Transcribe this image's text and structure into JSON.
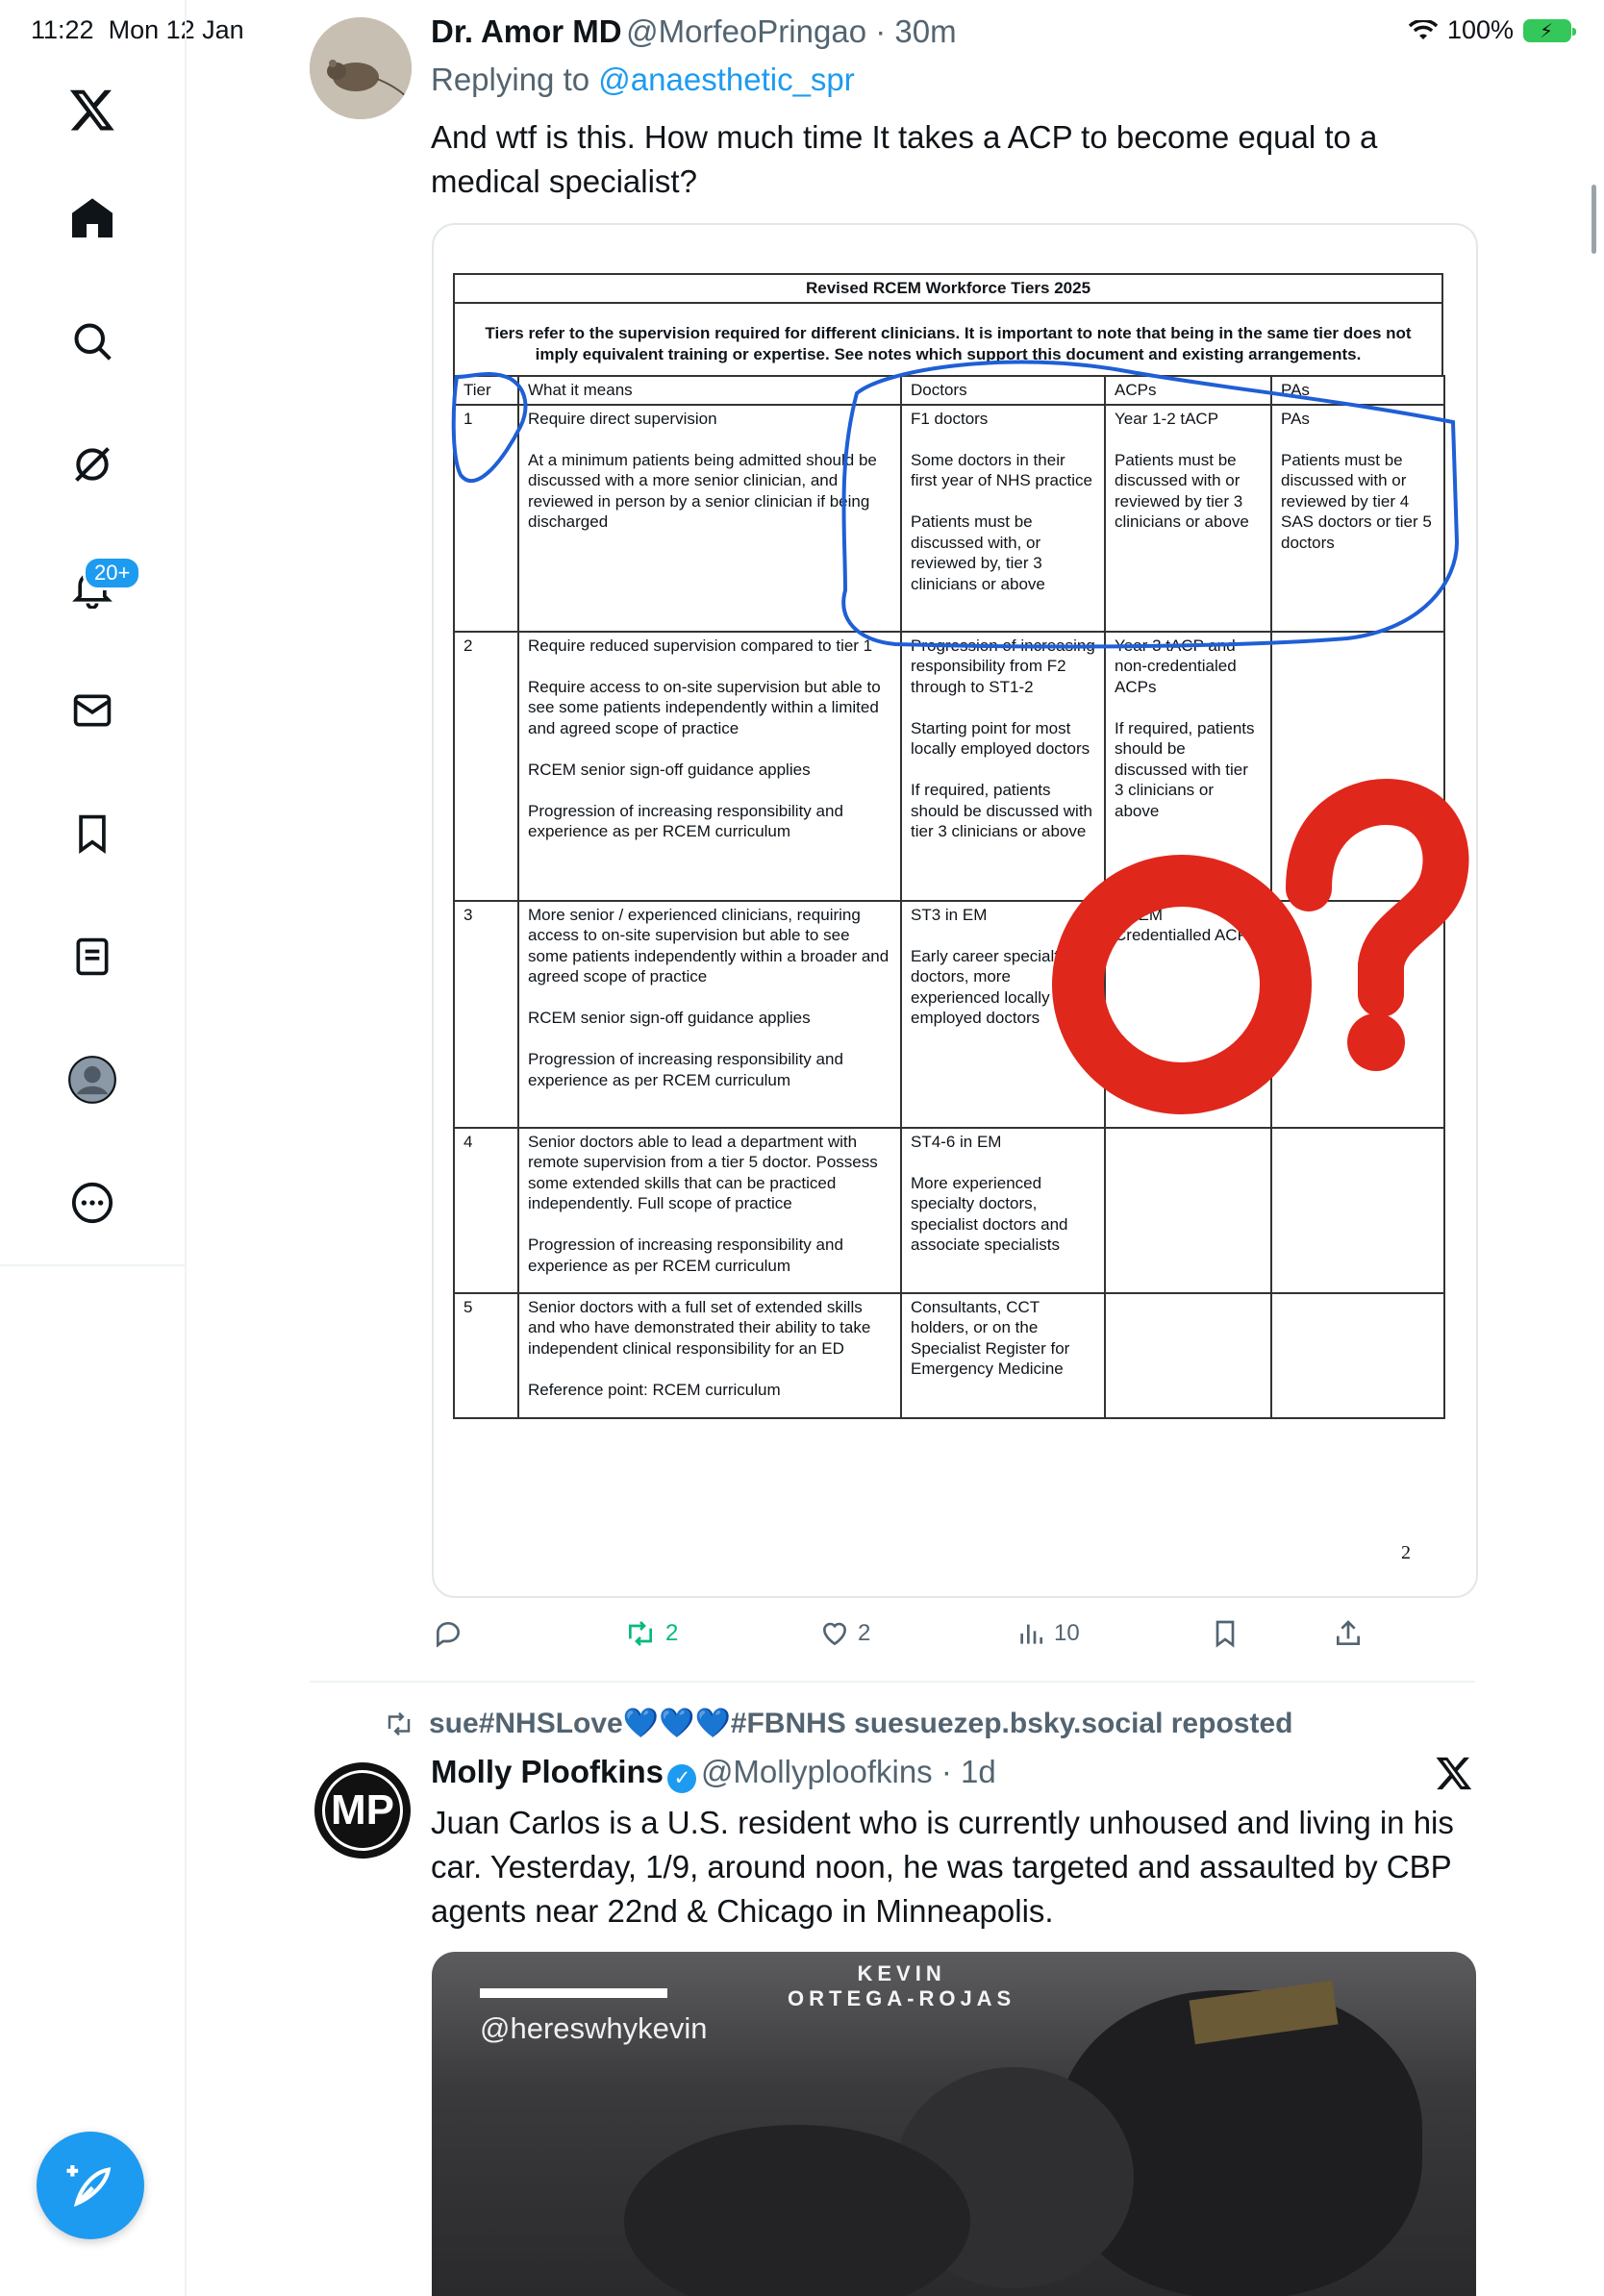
{
  "status_bar": {
    "time": "11:22",
    "date": "Mon 12 Jan",
    "battery": "100%"
  },
  "nav": {
    "notification_badge": "20+"
  },
  "tweet1": {
    "name": "Dr. Amor MD",
    "handle": "@MorfeoPringao",
    "time": "30m",
    "replying_label": "Replying to",
    "replying_handle": "@anaesthetic_spr",
    "text": "And wtf is this. How much time It takes a ACP to become equal to a medical specialist?",
    "document": {
      "title": "Revised RCEM Workforce Tiers 2025",
      "intro": "Tiers refer to the supervision required for different clinicians. It is important to note that being in the same tier does not imply equivalent training or expertise. See notes which support this document and existing arrangements.",
      "headers": [
        "Tier",
        "What it means",
        "Doctors",
        "ACPs",
        "PAs"
      ],
      "rows": [
        [
          "1",
          "Require direct supervision\n\nAt a minimum patients being admitted should be discussed with a more senior clinician, and reviewed in person by a senior clinician if being discharged",
          "F1 doctors\n\nSome doctors in their first year of NHS practice\n\nPatients must be discussed with, or reviewed by, tier 3 clinicians or above",
          "Year 1-2 tACP\n\nPatients must be discussed with or reviewed by tier 3 clinicians or above",
          "PAs\n\nPatients must be discussed with or reviewed by tier 4 SAS doctors or tier 5 doctors"
        ],
        [
          "2",
          "Require reduced supervision compared to tier 1\n\nRequire access to on-site supervision but able to see some patients independently within a limited and agreed scope of practice\n\nRCEM senior sign-off guidance applies\n\nProgression of increasing responsibility and experience as per RCEM curriculum",
          "Progression of increasing responsibility from F2 through to ST1-2\n\nStarting point for most locally employed doctors\n\nIf required, patients should be discussed with tier 3 clinicians or above",
          "Year 3 tACP and non-credentialed ACPs\n\nIf required, patients should be discussed with tier 3 clinicians or above",
          ""
        ],
        [
          "3",
          "More senior / experienced clinicians, requiring access to on-site supervision but able to see some patients independently within a broader and agreed scope of practice\n\nRCEM senior sign-off guidance applies\n\nProgression of increasing responsibility and experience as per RCEM curriculum",
          "ST3 in EM\n\nEarly career specialty doctors, more experienced locally employed doctors",
          "RCEM Credentialled ACPs",
          ""
        ],
        [
          "4",
          "Senior doctors able to lead a department with remote supervision from a tier 5 doctor. Possess some extended skills that can be practiced independently. Full scope of practice\n\nProgression of increasing responsibility and experience as per RCEM curriculum",
          "ST4-6 in EM\n\nMore experienced specialty doctors, specialist doctors and associate specialists",
          "",
          ""
        ],
        [
          "5",
          "Senior doctors with a full set of extended skills and who have demonstrated their ability to take independent clinical responsibility for an ED\n\nReference point: RCEM curriculum",
          "Consultants, CCT holders, or on the Specialist Register for Emergency Medicine",
          "",
          ""
        ]
      ],
      "page_number": "2"
    },
    "stats": {
      "replies": "",
      "reposts": "2",
      "likes": "2",
      "views": "10"
    }
  },
  "tweet2": {
    "repost_label": "sue#NHSLove💙💙💙#FBNHS suesuezep.bsky.social reposted",
    "avatar_initials": "MP",
    "name": "Molly Ploofkins",
    "handle": "@Mollyploofkins",
    "time": "1d",
    "text": "Juan Carlos is a U.S. resident who is currently unhoused and living in his car. Yesterday, 1/9, around noon, he was targeted and assaulted by CBP agents near 22nd & Chicago in Minneapolis.",
    "video_watermark_name": "KEVIN\nORTEGA-ROJAS",
    "video_watermark_handle": "@hereswhykevin"
  },
  "colors": {
    "accent": "#1d9bf0",
    "repost_green": "#00ba7c",
    "annotation_blue": "#1f5fd6",
    "overlay_red": "#e0271c"
  }
}
